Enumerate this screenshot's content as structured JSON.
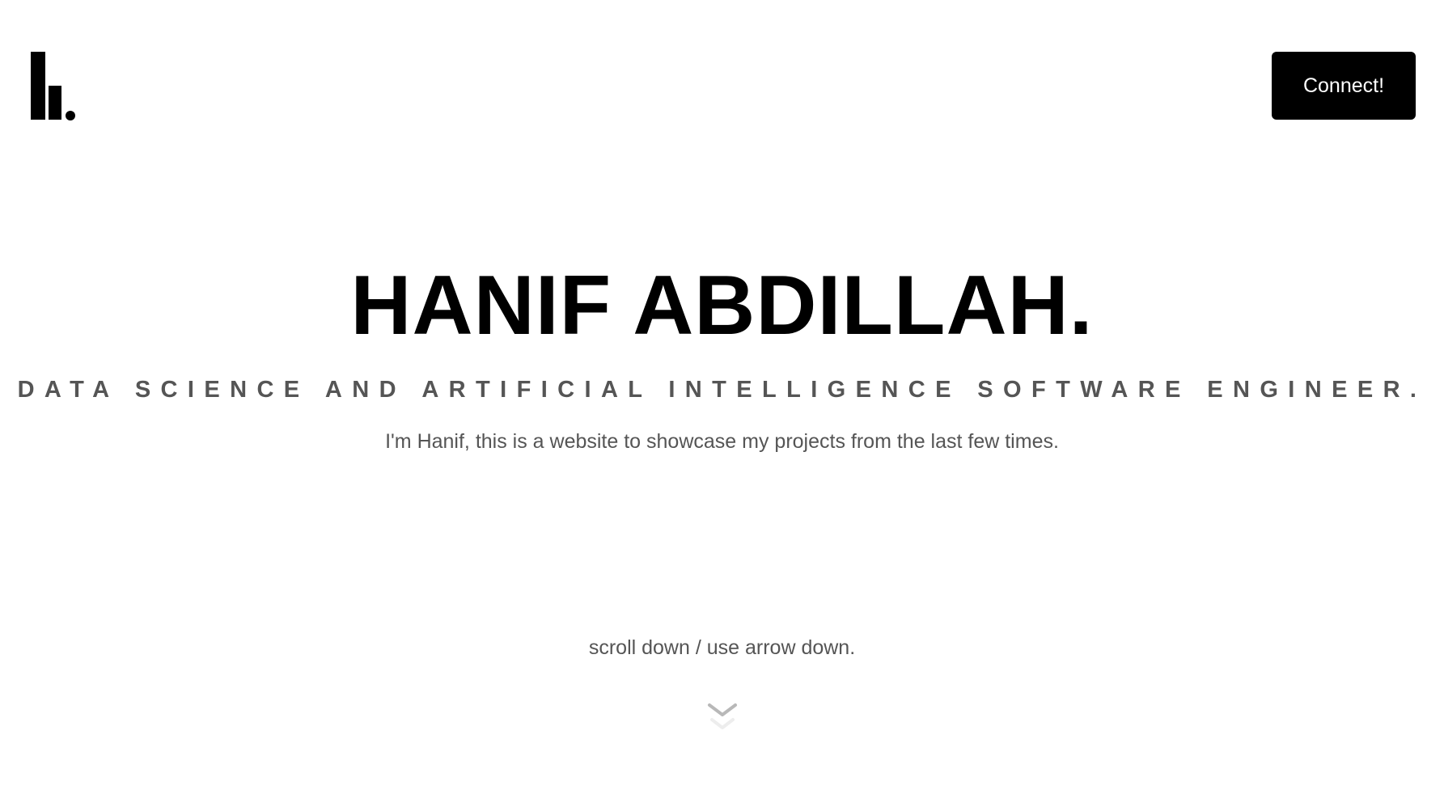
{
  "header": {
    "logo_icon": "brand-logo-icon",
    "connect_label": "Connect!"
  },
  "hero": {
    "name": "HANIF ABDILLAH.",
    "role": "DATA SCIENCE AND ARTIFICIAL INTELLIGENCE SOFTWARE ENGINEER.",
    "intro": "I'm Hanif, this is a website to showcase my projects from the last few times."
  },
  "scroll": {
    "hint": "scroll down / use arrow down.",
    "icon": "chevron-down-icon"
  },
  "colors": {
    "background": "#ffffff",
    "primary": "#000000",
    "muted_text": "#555555",
    "button_text": "#ffffff",
    "arrow": "#bbbbbb"
  }
}
